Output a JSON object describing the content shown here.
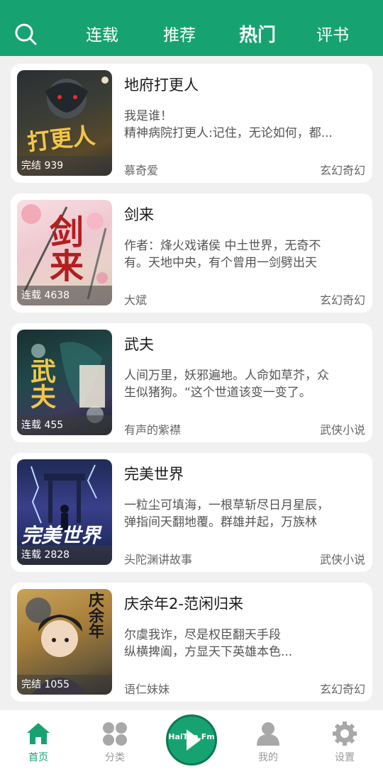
{
  "header": {
    "tabs": [
      {
        "label": "连载"
      },
      {
        "label": "推荐"
      },
      {
        "label": "热门"
      },
      {
        "label": "评书"
      }
    ],
    "active_tab": "热门",
    "icon": "search-icon",
    "colors": {
      "primary": "#16a371"
    }
  },
  "books": [
    {
      "title": "地府打更人",
      "desc": [
        "我是谁！",
        "精神病院打更人:记住，无论如何，都..."
      ],
      "author": "慕奇爱",
      "genre": "玄幻奇幻",
      "badge": "完结 939",
      "cover_text": "打更人"
    },
    {
      "title": "剑来",
      "desc": [
        "作者：烽火戏诸侯 中土世界，无奇不",
        "有。天地中央，有个曾用一剑劈出天"
      ],
      "author": "大斌",
      "genre": "玄幻奇幻",
      "badge": "连载 4638",
      "cover_text": "剑来"
    },
    {
      "title": "武夫",
      "desc": [
        "人间万里，妖邪遍地。人命如草芥，众",
        "生似猪狗。“这个世道该变一变了。"
      ],
      "author": "有声的紫襟",
      "genre": "武侠小说",
      "badge": "连载 455",
      "cover_text": "武夫"
    },
    {
      "title": "完美世界",
      "desc": [
        "一粒尘可填海，一根草斩尽日月星辰，",
        "弹指间天翻地覆。群雄并起，万族林"
      ],
      "author": "头陀渊讲故事",
      "genre": "武侠小说",
      "badge": "连载 2828",
      "cover_text": "完美世界"
    },
    {
      "title": "庆余年2-范闲归来",
      "desc": [
        "尔虞我诈，尽是权臣翻天手段",
        "纵横捭阖，方显天下英雄本色..."
      ],
      "author": "语仁妹妹",
      "genre": "玄幻奇幻",
      "badge": "完结 1055",
      "cover_text": "庆余年"
    }
  ],
  "bottom_nav": {
    "items": [
      {
        "label": "首页",
        "icon": "home-icon"
      },
      {
        "label": "分类",
        "icon": "grid-icon"
      },
      {
        "label": "我的",
        "icon": "user-icon"
      },
      {
        "label": "设置",
        "icon": "gear-icon"
      }
    ],
    "center_label": "HaiTun.Fm",
    "center_icon": "play-icon"
  }
}
